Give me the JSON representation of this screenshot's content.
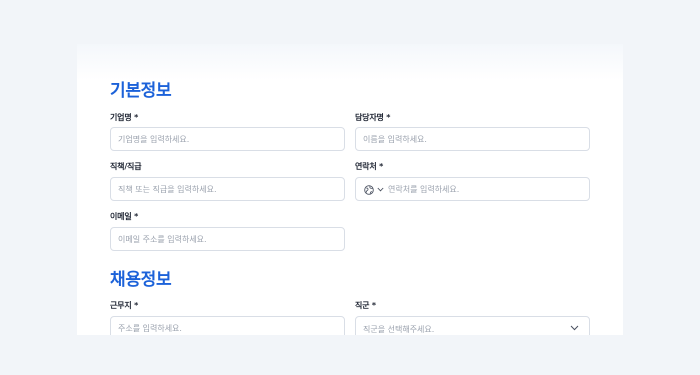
{
  "sections": {
    "basic": {
      "title": "기본정보",
      "company_name": {
        "label": "기업명 *",
        "placeholder": "기업명을 입력하세요."
      },
      "manager_name": {
        "label": "담당자명 *",
        "placeholder": "이름을 입력하세요."
      },
      "position": {
        "label": "직책/직급",
        "placeholder": "직책 또는 직급을 입력하세요."
      },
      "contact": {
        "label": "연락처 *",
        "placeholder": "연락처를 입력하세요.",
        "country_icon": "globe-icon"
      },
      "email": {
        "label": "이메일 *",
        "placeholder": "이메일 주소를 입력하세요."
      }
    },
    "recruit": {
      "title": "채용정보",
      "location": {
        "label": "근무지 *",
        "placeholder": "주소를 입력하세요."
      },
      "job_group": {
        "label": "직군 *",
        "placeholder": "직군을 선택해주세요."
      }
    }
  },
  "colors": {
    "accent": "#1c62d9",
    "page_background": "#f2f5f9",
    "border": "#d9dee6",
    "placeholder": "#9aa1ad"
  }
}
